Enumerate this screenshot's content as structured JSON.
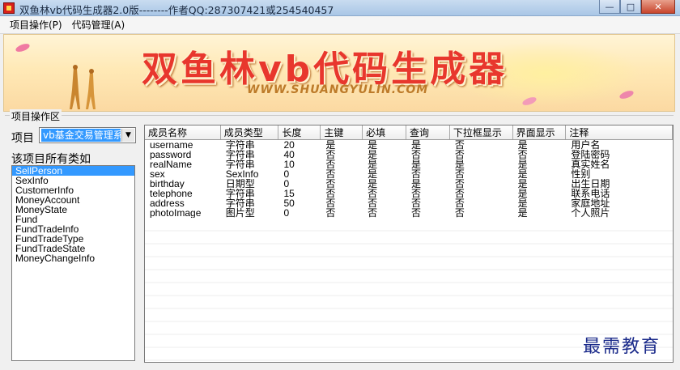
{
  "window": {
    "title": "双鱼林vb代码生成器2.0版--------作者QQ:287307421或254540457"
  },
  "menu": [
    {
      "label": "项目操作(P)"
    },
    {
      "label": "代码管理(A)"
    }
  ],
  "banner": {
    "title": "双鱼林vb代码生成器",
    "url": "WWW.SHUANGYULIN.COM"
  },
  "project_area": {
    "group_label": "项目操作区",
    "project_label": "项目",
    "project_selected": "vb基金交易管理系统",
    "classes_label": "该项目所有类如"
  },
  "classes": [
    "SellPerson",
    "SexInfo",
    "CustomerInfo",
    "MoneyAccount",
    "MoneyState",
    "Fund",
    "FundTradeInfo",
    "FundTradeType",
    "FundTradeState",
    "MoneyChangeInfo"
  ],
  "selected_class_index": 0,
  "grid": {
    "columns": [
      "成员名称",
      "成员类型",
      "长度",
      "主键",
      "必填",
      "查询",
      "下拉框显示",
      "界面显示",
      "注释"
    ],
    "rows": [
      [
        "username",
        "字符串",
        "20",
        "是",
        "是",
        "是",
        "否",
        "是",
        "用户名"
      ],
      [
        "password",
        "字符串",
        "40",
        "否",
        "是",
        "否",
        "否",
        "否",
        "登陆密码"
      ],
      [
        "realName",
        "字符串",
        "10",
        "否",
        "是",
        "是",
        "是",
        "是",
        "真实姓名"
      ],
      [
        "sex",
        "SexInfo",
        "0",
        "否",
        "是",
        "否",
        "否",
        "是",
        "性别"
      ],
      [
        "birthday",
        "日期型",
        "0",
        "否",
        "是",
        "是",
        "否",
        "是",
        "出生日期"
      ],
      [
        "telephone",
        "字符串",
        "15",
        "否",
        "否",
        "否",
        "否",
        "是",
        "联系电话"
      ],
      [
        "address",
        "字符串",
        "50",
        "否",
        "否",
        "否",
        "否",
        "是",
        "家庭地址"
      ],
      [
        "photoImage",
        "图片型",
        "0",
        "否",
        "否",
        "否",
        "否",
        "是",
        "个人照片"
      ]
    ]
  },
  "watermark": "最需教育"
}
